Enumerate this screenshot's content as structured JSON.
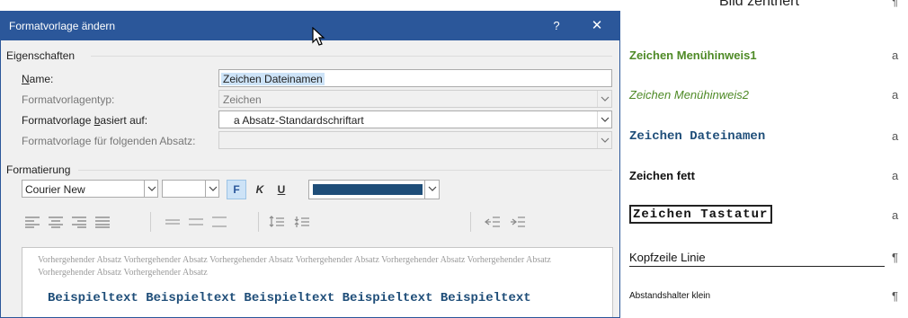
{
  "dialog": {
    "title": "Formatvorlage ändern",
    "help_label": "?",
    "close_label": "✕",
    "sections": {
      "properties": "Eigenschaften",
      "formatting": "Formatierung"
    },
    "properties": {
      "name_label_pre": "",
      "name_label_ul": "N",
      "name_label_post": "ame:",
      "name_value": "Zeichen Dateinamen",
      "type_label": "Formatvorlagentyp:",
      "type_value": "Zeichen",
      "based_label_pre": "Formatvorlage ",
      "based_label_ul": "b",
      "based_label_post": "asiert auf:",
      "based_value": "a Absatz-Standardschriftart",
      "next_label": "Formatvorlage für folgenden Absatz:",
      "next_value": ""
    },
    "formatting": {
      "font": "Courier New",
      "size": "",
      "bold_label": "F",
      "italic_label": "K",
      "underline_label": "U",
      "color": "#1f4e79"
    },
    "preview": {
      "previous_text": "Vorhergehender Absatz Vorhergehender Absatz Vorhergehender Absatz Vorhergehender Absatz Vorhergehender Absatz Vorhergehender Absatz Vorhergehender Absatz Vorhergehender Absatz",
      "sample_text": "Beispieltext Beispieltext Beispieltext Beispieltext Beispieltext"
    }
  },
  "gallery": {
    "items": [
      {
        "name": "Bild zentriert",
        "mark": "¶"
      },
      {
        "name": "Zeichen Menühinweis1",
        "mark": "a"
      },
      {
        "name": "Zeichen Menühinweis2",
        "mark": "a"
      },
      {
        "name": "Zeichen Dateinamen",
        "mark": "a"
      },
      {
        "name": "Zeichen fett",
        "mark": "a"
      },
      {
        "name": "Zeichen Tastatur",
        "mark": "a"
      },
      {
        "name": "Kopfzeile Linie",
        "mark": "¶"
      },
      {
        "name": "Abstandshalter klein",
        "mark": "¶"
      }
    ]
  },
  "colors": {
    "titlebar": "#2b579a",
    "accent_green": "#4e8a26",
    "accent_blue": "#1f4e79"
  }
}
